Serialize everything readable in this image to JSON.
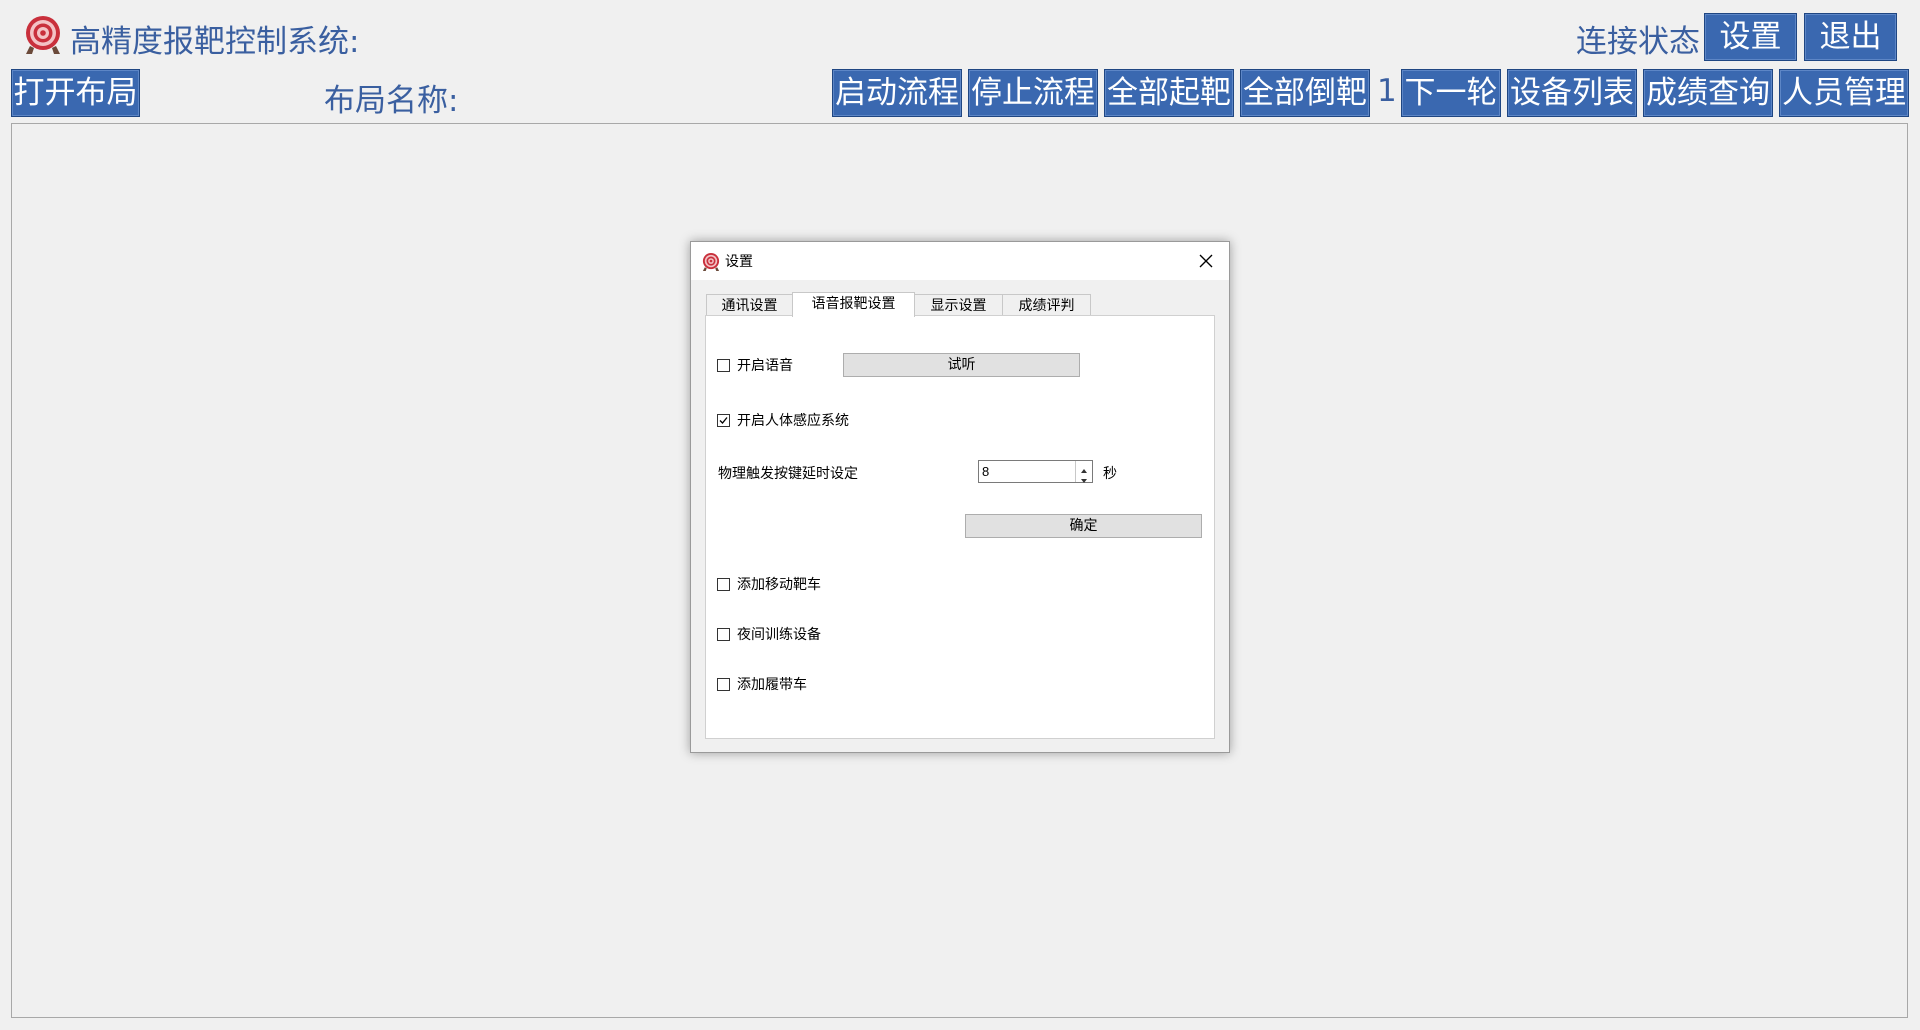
{
  "header": {
    "title": "高精度报靶控制系统:",
    "connection_status": "连接状态",
    "settings_button": "设置",
    "exit_button": "退出"
  },
  "toolbar": {
    "open_layout": "打开布局",
    "layout_name_label": "布局名称:",
    "start_process": "启动流程",
    "stop_process": "停止流程",
    "raise_all": "全部起靶",
    "lower_all": "全部倒靶",
    "round_number": "1",
    "next_round": "下一轮",
    "device_list": "设备列表",
    "score_query": "成绩查询",
    "personnel": "人员管理"
  },
  "dialog": {
    "title": "设置",
    "tabs": [
      {
        "label": "通讯设置"
      },
      {
        "label": "语音报靶设置"
      },
      {
        "label": "显示设置"
      },
      {
        "label": "成绩评判"
      }
    ],
    "active_tab": "语音报靶设置",
    "voice": {
      "enable_voice_label": "开启语音",
      "enable_voice_checked": false,
      "preview_button": "试听",
      "body_sensor_label": "开启人体感应系统",
      "body_sensor_checked": true,
      "delay_label": "物理触发按键延时设定",
      "delay_value": "8",
      "delay_unit": "秒",
      "confirm_button": "确定",
      "moving_target_label": "添加移动靶车",
      "moving_target_checked": false,
      "night_training_label": "夜间训练设备",
      "night_training_checked": false,
      "tracked_vehicle_label": "添加履带车",
      "tracked_vehicle_checked": false
    }
  },
  "colors": {
    "accent_blue": "#3a68b0",
    "title_text": "#3a5fa0",
    "logo_red": "#c9303c"
  },
  "icons": {
    "logo": "target-logo-icon",
    "close": "close-icon",
    "check": "check-icon",
    "spin_up": "chevron-up-icon",
    "spin_down": "chevron-down-icon"
  }
}
